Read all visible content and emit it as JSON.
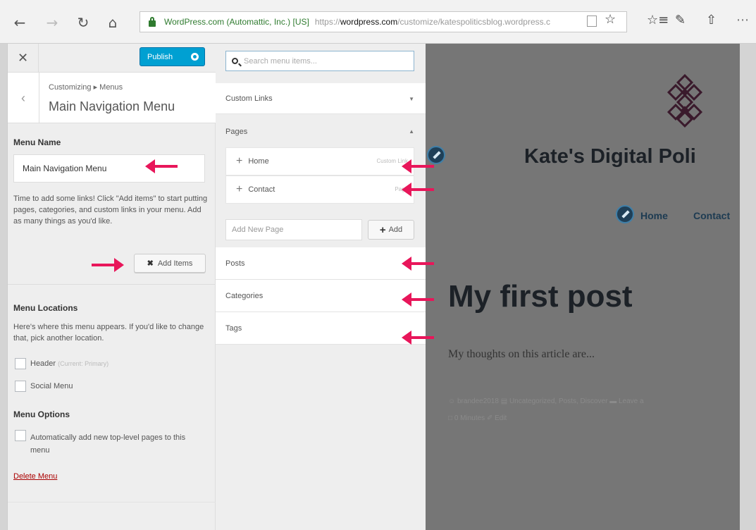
{
  "browser": {
    "cert": "WordPress.com (Automattic, Inc.) [US]",
    "url_prefix": "https://",
    "url_host": "wordpress.com",
    "url_path": "/customize/katespoliticsblog.wordpress.c"
  },
  "header": {
    "publish_label": "Publish"
  },
  "section": {
    "breadcrumb": "Customizing ▸ Menus",
    "title": "Main Navigation Menu"
  },
  "menu": {
    "name_label": "Menu Name",
    "name_value": "Main Navigation Menu",
    "help_text": "Time to add some links! Click \"Add items\" to start putting pages, categories, and custom links in your menu. Add as many things as you'd like.",
    "add_items_label": "Add Items",
    "locations_label": "Menu Locations",
    "locations_help": "Here's where this menu appears. If you'd like to change that, pick another location.",
    "locations": [
      {
        "label": "Header",
        "note": "(Current: Primary)"
      },
      {
        "label": "Social Menu",
        "note": ""
      }
    ],
    "options_label": "Menu Options",
    "auto_add_label": "Automatically add new top-level pages to this menu",
    "delete_label": "Delete Menu"
  },
  "available": {
    "search_placeholder": "Search menu items...",
    "sections": {
      "custom_links": "Custom Links",
      "pages": "Pages",
      "posts": "Posts",
      "categories": "Categories",
      "tags": "Tags"
    },
    "pages": [
      {
        "label": "Home",
        "type": "Custom Link"
      },
      {
        "label": "Contact",
        "type": "Page"
      }
    ],
    "new_page_placeholder": "Add New Page",
    "add_label": "Add"
  },
  "preview": {
    "site_title": "Kate's Digital Poli",
    "nav": [
      "Home",
      "Contact"
    ],
    "post_title": "My first post",
    "excerpt": "My thoughts on this article are...",
    "meta_line1": "☺  brandee2018      ▤  Uncategorized, Posts, Discover      ▬  Leave a",
    "meta_line2": "□  0 Minutes     ✐  Edit"
  },
  "colors": {
    "accent": "#00a0d2",
    "annotation_arrow": "#e8165a",
    "preview_overlay": "#767676"
  }
}
